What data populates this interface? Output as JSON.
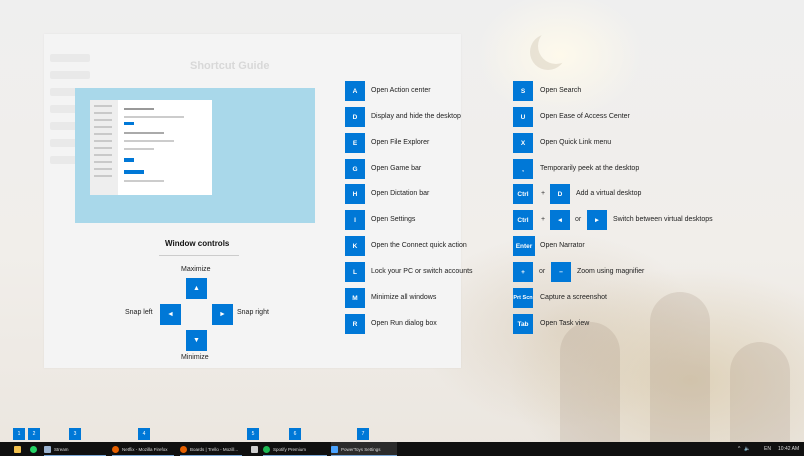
{
  "preview": {
    "ghost_title": "Shortcut Guide",
    "section_title": "Window controls",
    "maximize_label": "Maximize",
    "minimize_label": "Minimize",
    "snap_left_label": "Snap left",
    "snap_right_label": "Snap right",
    "arrow_up": "▲",
    "arrow_down": "▼",
    "arrow_left": "◄",
    "arrow_right": "►"
  },
  "shortcuts_left": [
    {
      "key": "A",
      "desc": "Open Action center"
    },
    {
      "key": "D",
      "desc": "Display and hide the desktop"
    },
    {
      "key": "E",
      "desc": "Open File Explorer"
    },
    {
      "key": "G",
      "desc": "Open Game bar"
    },
    {
      "key": "H",
      "desc": "Open Dictation bar"
    },
    {
      "key": "I",
      "desc": "Open Settings"
    },
    {
      "key": "K",
      "desc": "Open the Connect quick action"
    },
    {
      "key": "L",
      "desc": "Lock your PC or switch accounts"
    },
    {
      "key": "M",
      "desc": "Minimize all windows"
    },
    {
      "key": "R",
      "desc": "Open Run dialog box"
    }
  ],
  "shortcuts_right": {
    "s": {
      "key": "S",
      "desc": "Open Search"
    },
    "u": {
      "key": "U",
      "desc": "Open Ease of Access Center"
    },
    "x": {
      "key": "X",
      "desc": "Open Quick Link menu"
    },
    "comma": {
      "key": ",",
      "desc": "Temporarily peek at the desktop"
    },
    "ctrl_d": {
      "key1": "Ctrl",
      "plus": "+",
      "key2": "D",
      "desc": "Add a virtual desktop"
    },
    "ctrl_arrows": {
      "key1": "Ctrl",
      "plus": "+",
      "key2": "◄",
      "or": "or",
      "key3": "►",
      "desc": "Switch between virtual desktops"
    },
    "enter": {
      "key": "Enter",
      "desc": "Open Narrator"
    },
    "zoom": {
      "key1": "+",
      "or": "or",
      "key2": "−",
      "desc": "Zoom using magnifier"
    },
    "prtscn": {
      "key": "Prt Scn",
      "desc": "Capture a screenshot"
    },
    "tab": {
      "key": "Tab",
      "desc": "Open Task view"
    }
  },
  "taskbar": {
    "numbers": [
      "1",
      "2",
      "3",
      "4",
      "5",
      "6",
      "7"
    ],
    "items": [
      {
        "label": "Stream"
      },
      {
        "label": "Netflix - Mozilla Firefox"
      },
      {
        "label": "Boards | Trello - Mozill..."
      },
      {
        "label": "Spotify Premium"
      },
      {
        "label": "PowerToys Settings"
      }
    ],
    "tray_lang": "EN",
    "clock": "10:42 AM"
  }
}
